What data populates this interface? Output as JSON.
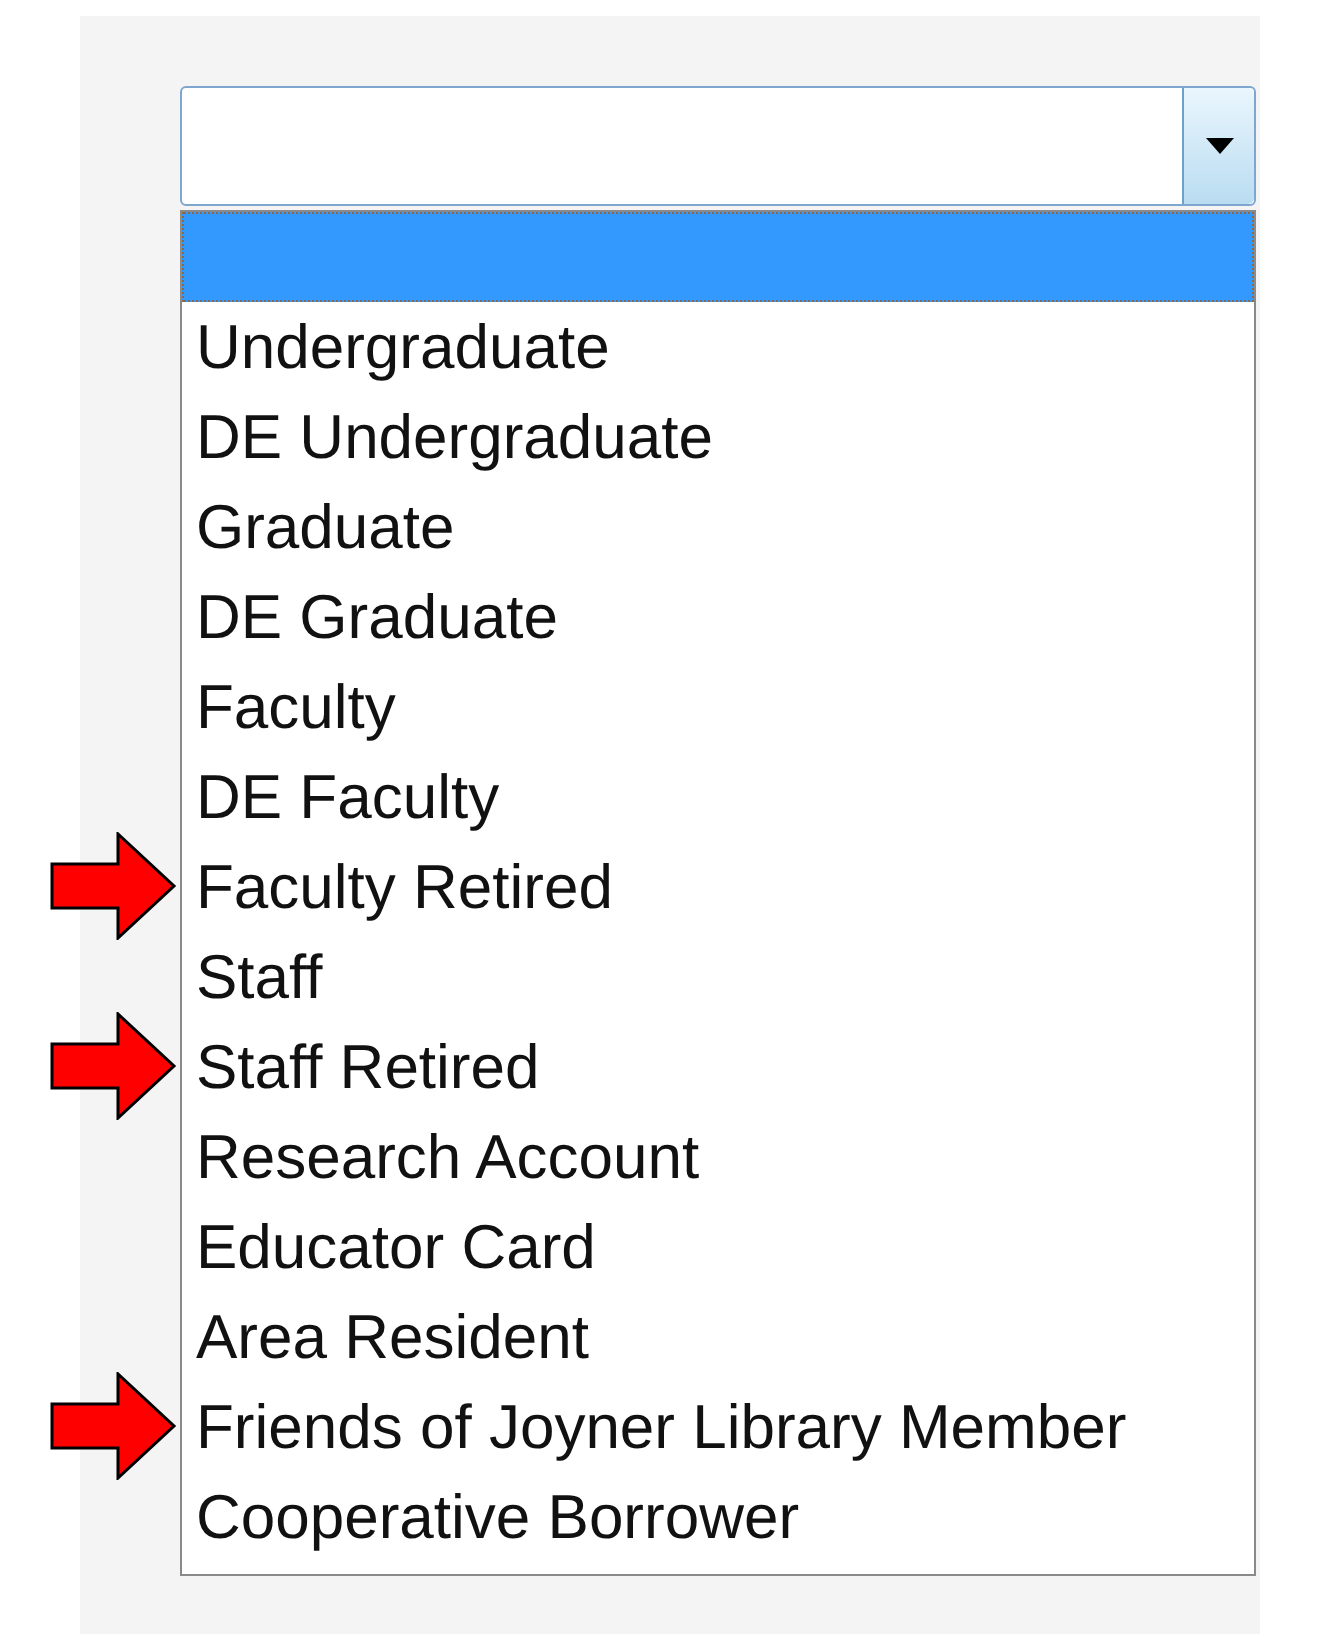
{
  "dropdown": {
    "expanded": true,
    "options": [
      {
        "selected": true
      },
      {
        "label": "Undergraduate",
        "selected": false,
        "flagged": false
      },
      {
        "label": "DE Undergraduate",
        "selected": false,
        "flagged": false
      },
      {
        "label": "Graduate",
        "selected": false,
        "flagged": false
      },
      {
        "label": "DE Graduate",
        "selected": false,
        "flagged": false
      },
      {
        "label": "Faculty",
        "selected": false,
        "flagged": false
      },
      {
        "label": "DE Faculty",
        "selected": false,
        "flagged": false
      },
      {
        "label": "Faculty Retired",
        "selected": false,
        "flagged": true
      },
      {
        "label": "Staff",
        "selected": false,
        "flagged": false
      },
      {
        "label": "Staff Retired",
        "selected": false,
        "flagged": true
      },
      {
        "label": "Research Account",
        "selected": false,
        "flagged": false
      },
      {
        "label": "Educator Card",
        "selected": false,
        "flagged": false
      },
      {
        "label": "Area Resident",
        "selected": false,
        "flagged": false
      },
      {
        "label": "Friends of Joyner Library Member",
        "selected": false,
        "flagged": true
      },
      {
        "label": "Cooperative Borrower",
        "selected": false,
        "flagged": false
      }
    ]
  }
}
